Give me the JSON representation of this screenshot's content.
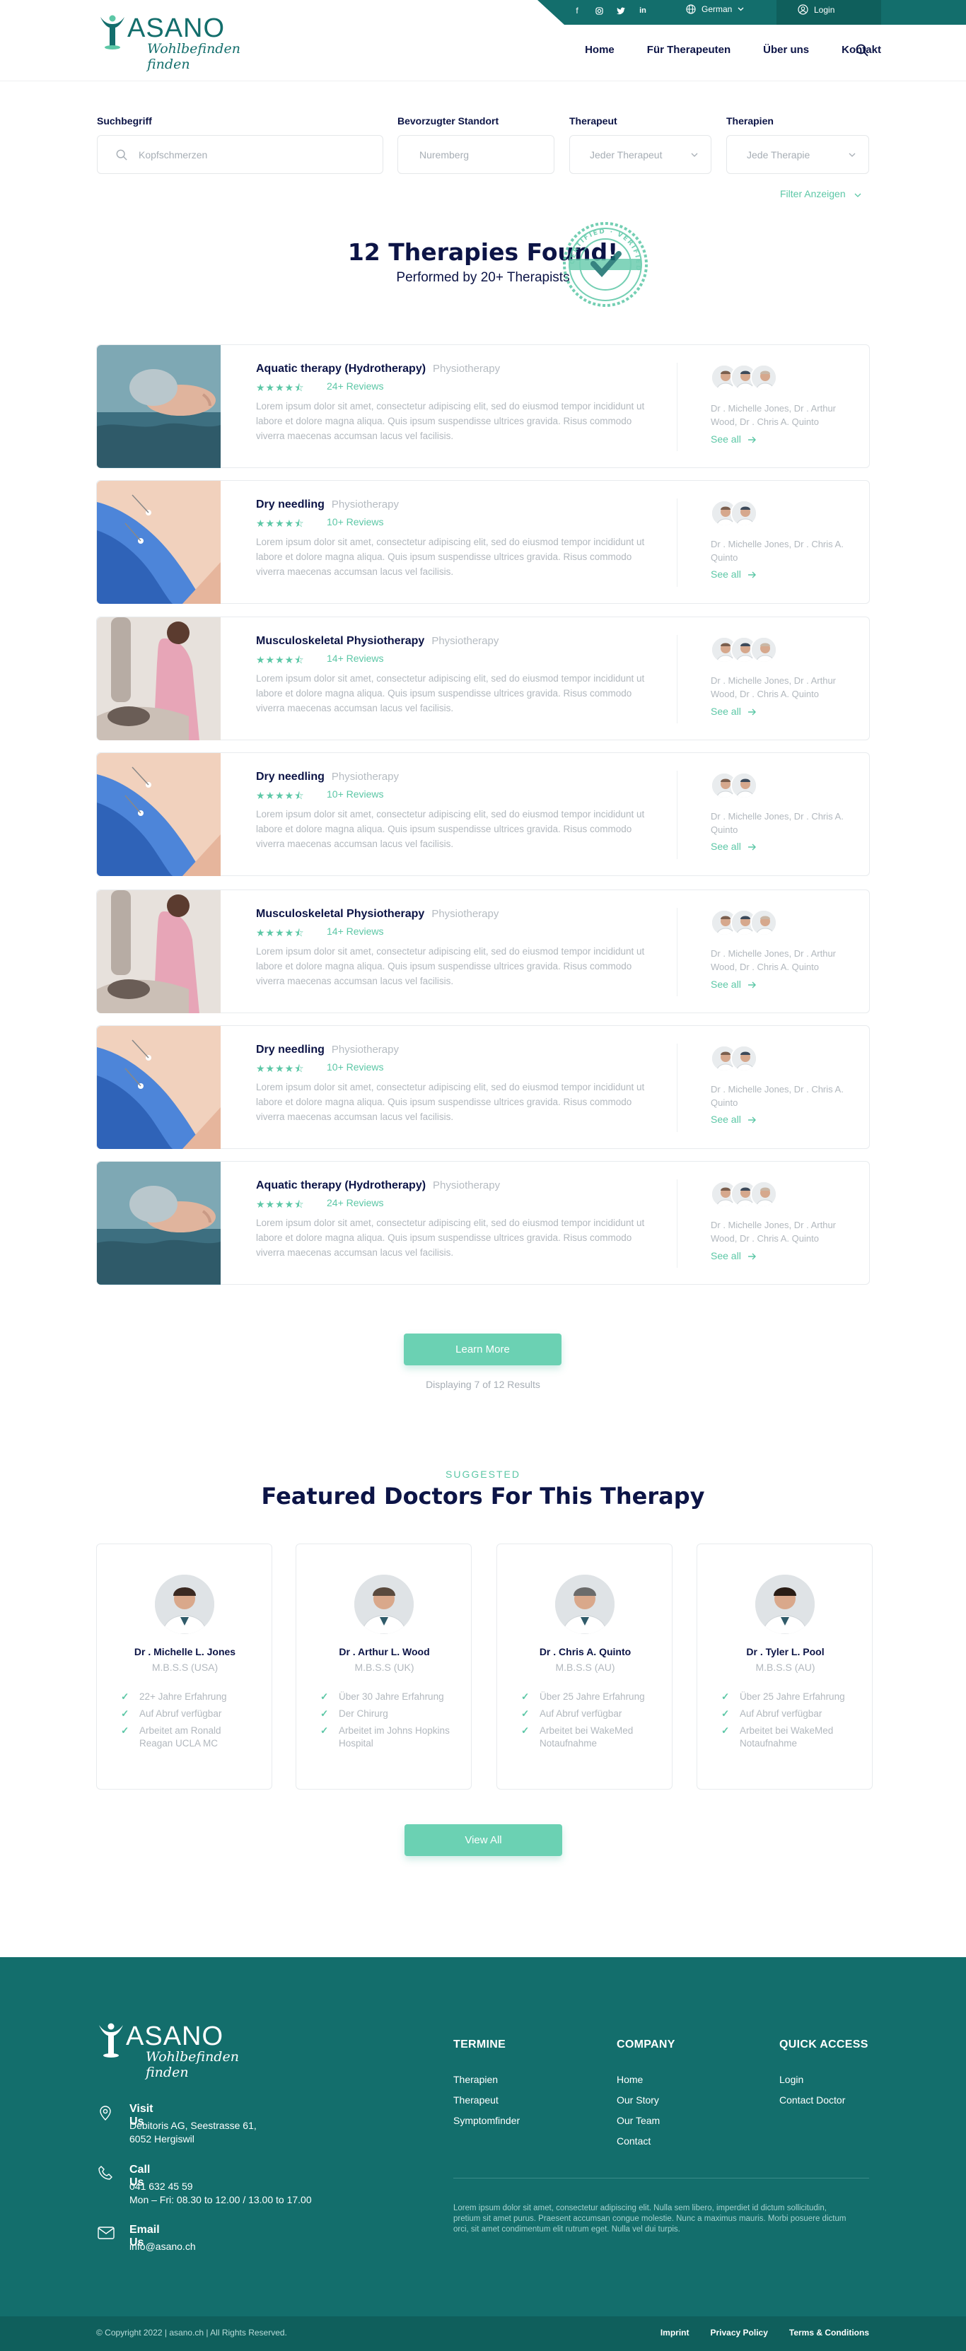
{
  "header": {
    "language": "German",
    "login": "Login",
    "logo": {
      "brand": "ASANO",
      "tagline": "Wohlbefinden finden"
    },
    "nav": [
      "Home",
      "Für Therapeuten",
      "Über uns",
      "Kontakt"
    ]
  },
  "filters": {
    "search": {
      "label": "Suchbegriff",
      "placeholder": "Kopfschmerzen"
    },
    "location": {
      "label": "Bevorzugter Standort",
      "placeholder": "Nuremberg"
    },
    "therapist": {
      "label": "Therapeut",
      "value": "Jeder Therapeut"
    },
    "therapies": {
      "label": "Therapien",
      "value": "Jede Therapie"
    },
    "show_filter": "Filter Anzeigen"
  },
  "results": {
    "title": "12 Therapies Found!",
    "subtitle": "Performed by 20+ Therapists",
    "stamp_text": "CERTIFIED · VERIFIED"
  },
  "common": {
    "description": "Lorem ipsum dolor sit amet, consectetur adipiscing elit, sed do eiusmod tempor incididunt ut labore et dolore magna aliqua. Quis ipsum suspendisse ultrices gravida. Risus commodo viverra maecenas accumsan lacus vel facilisis.",
    "see_all": "See all"
  },
  "therapies": [
    {
      "title": "Aquatic therapy (Hydrotherapy)",
      "category": "Physiotherapy",
      "reviews": "24+ Reviews",
      "rating": 4.5,
      "doctors": "Dr . Michelle Jones, Dr . Arthur Wood, Dr . Chris A. Quinto"
    },
    {
      "title": "Dry needling",
      "category": "Physiotherapy",
      "reviews": "10+ Reviews",
      "rating": 4.5,
      "doctors": "Dr . Michelle Jones, Dr . Chris A. Quinto"
    },
    {
      "title": "Musculoskeletal Physiotherapy",
      "category": "Physiotherapy",
      "reviews": "14+ Reviews",
      "rating": 4.5,
      "doctors": "Dr . Michelle Jones, Dr . Arthur Wood, Dr . Chris A. Quinto"
    },
    {
      "title": "Dry needling",
      "category": "Physiotherapy",
      "reviews": "10+ Reviews",
      "rating": 4.5,
      "doctors": "Dr . Michelle Jones, Dr . Chris A. Quinto"
    },
    {
      "title": "Musculoskeletal Physiotherapy",
      "category": "Physiotherapy",
      "reviews": "14+ Reviews",
      "rating": 4.5,
      "doctors": "Dr . Michelle Jones, Dr . Arthur Wood, Dr . Chris A. Quinto"
    },
    {
      "title": "Dry needling",
      "category": "Physiotherapy",
      "reviews": "10+ Reviews",
      "rating": 4.5,
      "doctors": "Dr . Michelle Jones, Dr . Chris A. Quinto"
    },
    {
      "title": "Aquatic therapy (Hydrotherapy)",
      "category": "Physiotherapy",
      "reviews": "24+ Reviews",
      "rating": 4.5,
      "doctors": "Dr . Michelle Jones, Dr . Arthur Wood, Dr . Chris A. Quinto"
    }
  ],
  "learn_more": "Learn More",
  "displaying": "Displaying 7 of 12 Results",
  "featured": {
    "eyebrow": "SUGGESTED",
    "title": "Featured Doctors For This Therapy",
    "doctors": [
      {
        "name": "Dr . Michelle L. Jones",
        "degree": "M.B.S.S (USA)",
        "points": [
          "22+ Jahre Erfahrung",
          "Auf Abruf verfügbar",
          "Arbeitet am Ronald Reagan UCLA MC"
        ]
      },
      {
        "name": "Dr . Arthur L. Wood",
        "degree": "M.B.S.S (UK)",
        "points": [
          "Über 30 Jahre Erfahrung",
          "Der Chirurg",
          "Arbeitet im Johns Hopkins Hospital"
        ]
      },
      {
        "name": "Dr . Chris A. Quinto",
        "degree": "M.B.S.S (AU)",
        "points": [
          "Über 25 Jahre Erfahrung",
          "Auf Abruf verfügbar",
          "Arbeitet bei WakeMed Notaufnahme"
        ]
      },
      {
        "name": "Dr . Tyler L. Pool",
        "degree": "M.B.S.S (AU)",
        "points": [
          "Über 25 Jahre Erfahrung",
          "Auf Abruf verfügbar",
          "Arbeitet bei WakeMed Notaufnahme"
        ]
      }
    ],
    "view_all": "View All"
  },
  "footer": {
    "visit": {
      "title": "Visit Us",
      "value": "Debitoris AG, Seestrasse 61, 6052 Hergiswil"
    },
    "call": {
      "title": "Call Us",
      "phone": "041 632 45 59",
      "hours": "Mon – Fri: 08.30 to 12.00 / 13.00 to 17.00"
    },
    "email": {
      "title": "Email Us",
      "value": "info@asano.ch"
    },
    "termine": {
      "title": "TERMINE",
      "links": [
        "Therapien",
        "Therapeut",
        "Symptomfinder"
      ]
    },
    "company": {
      "title": "COMPANY",
      "links": [
        "Home",
        "Our Story",
        "Our Team",
        "Contact"
      ]
    },
    "quick": {
      "title": "QUICK ACCESS",
      "links": [
        "Login",
        "Contact Doctor"
      ]
    },
    "lorem": "Lorem ipsum dolor sit amet, consectetur adipiscing elit. Nulla sem libero, imperdiet id dictum sollicitudin, pretium sit amet purus. Praesent accumsan congue molestie. Nunc a maximus mauris. Morbi posuere dictum orci, sit amet condimentum elit rutrum eget. Nulla vel dui turpis.",
    "copyright": "© Copyright 2022  |  asano.ch  |  All Rights Reserved.",
    "bottom_links": [
      "Imprint",
      "Privacy Policy",
      "Terms & Conditions"
    ]
  },
  "colors": {
    "teal": "#136e6c",
    "accent": "#5cc7a6",
    "navy": "#0c1446"
  }
}
